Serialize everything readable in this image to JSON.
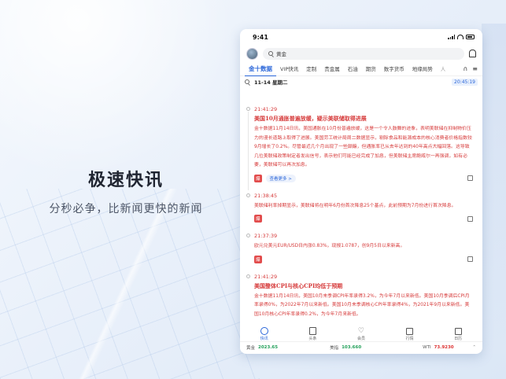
{
  "hero": {
    "title": "极速快讯",
    "subtitle": "分秒必争，比新闻更快的新闻"
  },
  "status": {
    "time": "9:41"
  },
  "search": {
    "placeholder": "黄金"
  },
  "tabs": [
    "金十数据",
    "VIP快讯",
    "定制",
    "贵金属",
    "石油",
    "期货",
    "数字货币",
    "地缘局势",
    "人"
  ],
  "date_row": {
    "date": "11-14 星期二",
    "time": "20:45:19"
  },
  "feed": [
    {
      "time": "21:41:29",
      "title": "美国10月通胀普遍放缓，疑示美联储取得进展",
      "body": "金十数据11月14日讯，美国通胀在10月份普遍放缓，这是一个令人鼓舞的迹象，表明美联储在抑制物价压力的漫长道路上取得了进展。美国劳工统计局周二数据显示，剔除食品和能源成本的核心消费者价格指数较9月增长了0.2%。尽管最近几个月出现了一些颠簸，但通胀率已从去年达到的40年高点大幅回落。这导致几位美联储政策制定者发出信号，表示他们可能已经完成了加息，但美联储主席鲍威尔一再强调，如有必要，美联储可以再次加息。",
      "badge": "爆",
      "more": "查看更多 >"
    },
    {
      "time": "21:38:45",
      "body": "美联储利率掉期显示，美联储将在明年6月份首次降息25个基点，此前预期为7月份进行首次降息。",
      "badge": "爆"
    },
    {
      "time": "21:37:39",
      "body": "欧元兑美元EUR/USD日内涨0.83%，现报1.0787，创9月5日以来新高。",
      "badge": "爆"
    },
    {
      "time": "21:41:29",
      "title": "美国整体CPI与核心CPI均低于预期",
      "body": "金十数据11月14日讯，美国10月未季调CPI年率录得3.2%，为今年7月以来新低。美国10月季调后CPI月率录得0%，为2022年7月以来新低。美国10月未季调核心CPI年率录得4%，为2021年9月以来新低。美国10月核心CPI年率录得0.2%，为今年7月来新低。"
    }
  ],
  "ticker": [
    {
      "name": "黄金",
      "value": "2023.65"
    },
    {
      "name": "美指",
      "value": "103.660"
    },
    {
      "name": "WTI",
      "value": "73.9230"
    }
  ],
  "bottom_nav": [
    "快讯",
    "头条",
    "会员",
    "行情",
    "日历"
  ],
  "colors": {
    "accent": "#2a66d9",
    "news_red": "#d63a3a",
    "up": "#23a05a",
    "down": "#dd3333"
  }
}
